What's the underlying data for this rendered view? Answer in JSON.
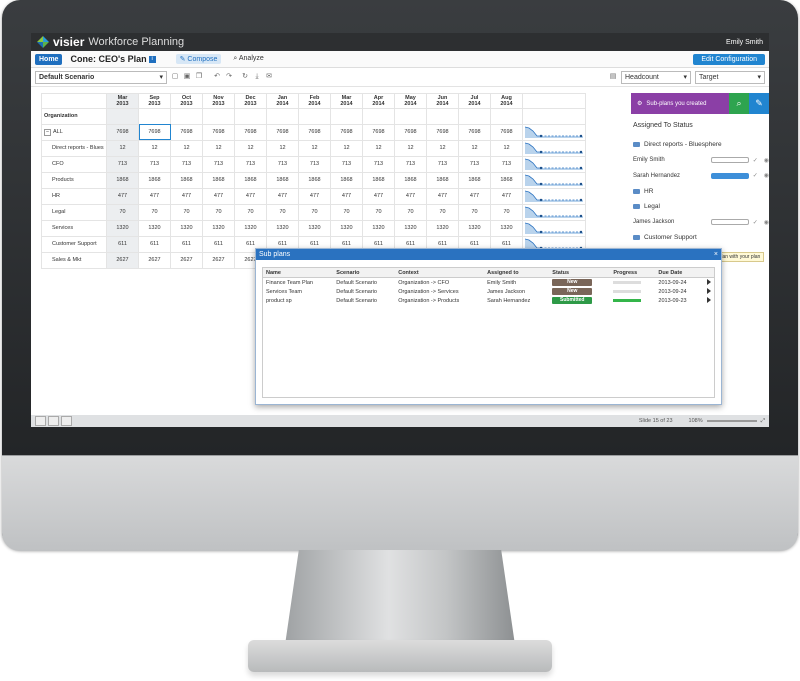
{
  "app": {
    "brand": "visier",
    "product": "Workforce Planning",
    "user": "Emily Smith"
  },
  "nav": {
    "home": "Home",
    "plan_title": "Cone: CEO's Plan",
    "info": "i",
    "compose": "Compose",
    "analyze": "Analyze",
    "edit_config": "Edit Configuration"
  },
  "toolbar": {
    "scenario": "Default Scenario",
    "measure": "Headcount",
    "target": "Target"
  },
  "table": {
    "row_header": "Organization",
    "months": [
      [
        "Mar",
        "2013"
      ],
      [
        "Sep",
        "2013"
      ],
      [
        "Oct",
        "2013"
      ],
      [
        "Nov",
        "2013"
      ],
      [
        "Dec",
        "2013"
      ],
      [
        "Jan",
        "2014"
      ],
      [
        "Feb",
        "2014"
      ],
      [
        "Mar",
        "2014"
      ],
      [
        "Apr",
        "2014"
      ],
      [
        "May",
        "2014"
      ],
      [
        "Jun",
        "2014"
      ],
      [
        "Jul",
        "2014"
      ],
      [
        "Aug",
        "2014"
      ]
    ],
    "rows": [
      {
        "label": "ALL",
        "value": "7698",
        "expand": "−"
      },
      {
        "label": "Direct reports - Blues",
        "value": "12"
      },
      {
        "label": "CFO",
        "value": "713"
      },
      {
        "label": "Products",
        "value": "1868"
      },
      {
        "label": "HR",
        "value": "477"
      },
      {
        "label": "Legal",
        "value": "70"
      },
      {
        "label": "Services",
        "value": "1320"
      },
      {
        "label": "Customer Support",
        "value": "611"
      },
      {
        "label": "Sales & Mkt",
        "value": "2627"
      }
    ]
  },
  "right_panel": {
    "banner": "Sub-plans you created",
    "heading": "Assigned To Status",
    "rows": [
      {
        "type": "folder",
        "label": "Direct reports - Bluesphere"
      },
      {
        "type": "person",
        "label": "Emily Smith",
        "bar": "empty"
      },
      {
        "type": "person",
        "label": "Sarah Hernandez",
        "bar": "fill"
      },
      {
        "type": "folder",
        "label": "HR"
      },
      {
        "type": "folder",
        "label": "Legal"
      },
      {
        "type": "person",
        "label": "James Jackson",
        "bar": "empty"
      },
      {
        "type": "folder",
        "label": "Customer Support"
      }
    ],
    "tooltip": "Compare this sub plan with your plan"
  },
  "modal": {
    "title": "Sub plans",
    "close": "×",
    "headers": [
      "Name",
      "Scenario",
      "Context",
      "Assigned to",
      "Status",
      "Progress",
      "Due Date"
    ],
    "rows": [
      {
        "name": "Finance Team Plan",
        "scenario": "Default Scenario",
        "context": "Organization -> CFO",
        "assigned": "Emily Smith",
        "status": "New",
        "status_color": "#7a6659",
        "progress": 0,
        "due": "2013-09-24"
      },
      {
        "name": "Services Team",
        "scenario": "Default Scenario",
        "context": "Organization -> Services",
        "assigned": "James Jackson",
        "status": "New",
        "status_color": "#7a6659",
        "progress": 0,
        "due": "2013-09-24"
      },
      {
        "name": "product sp",
        "scenario": "Default Scenario",
        "context": "Organization -> Products",
        "assigned": "Sarah Hernandez",
        "status": "Submitted",
        "status_color": "#2e9a47",
        "progress": 1,
        "due": "2013-09-23"
      }
    ]
  },
  "statusbar": {
    "slide": "Slide 15 of 23",
    "zoom": "108%"
  }
}
